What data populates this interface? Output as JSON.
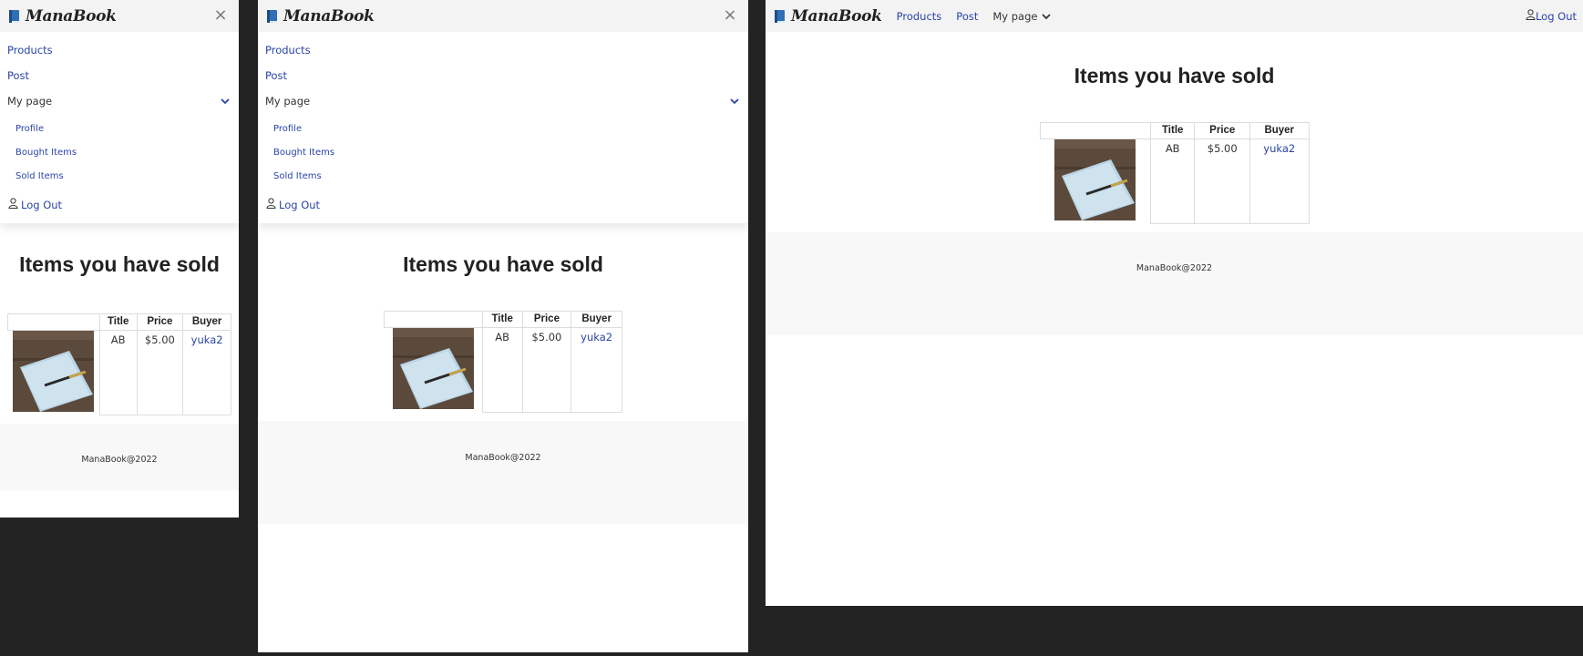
{
  "brand": {
    "name": "ManaBook"
  },
  "menu": {
    "products": "Products",
    "post": "Post",
    "my_page": "My page",
    "profile": "Profile",
    "bought_items": "Bought Items",
    "sold_items": "Sold Items",
    "logout": "Log Out"
  },
  "page": {
    "title": "Items you have sold"
  },
  "table": {
    "headers": [
      "",
      "Title",
      "Price",
      "Buyer"
    ],
    "rows": [
      {
        "title": "AB",
        "price": "$5.00",
        "buyer": "yuka2"
      }
    ]
  },
  "footer": {
    "text": "ManaBook@2022"
  },
  "icons": {
    "brand": "book-icon",
    "close": "close-icon",
    "chevron": "chevron-down-icon",
    "user": "user-icon"
  },
  "colors": {
    "link": "#2a44a8",
    "navbar": "#f3f3f3",
    "footer": "#f8f8f8",
    "backdrop": "#232323"
  }
}
